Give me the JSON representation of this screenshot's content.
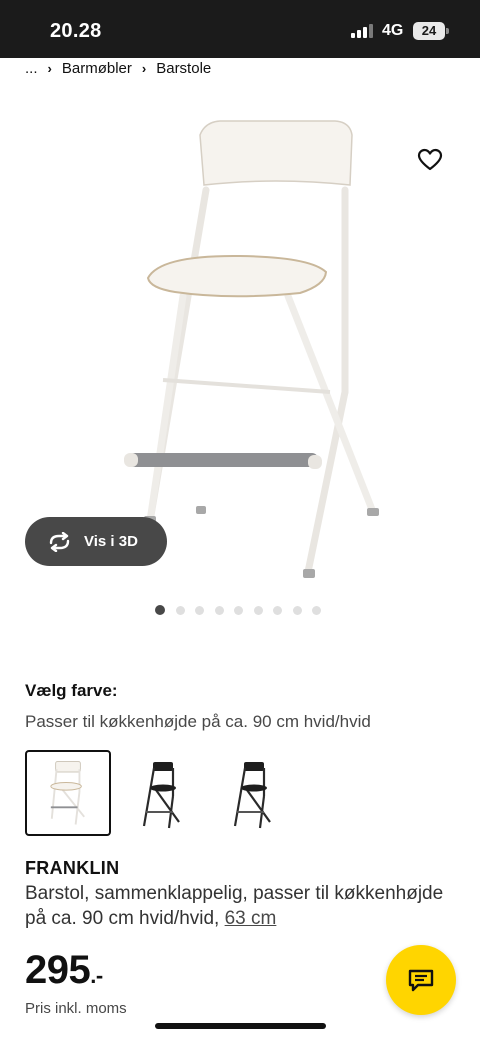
{
  "status_bar": {
    "time": "20.28",
    "network": "4G",
    "battery": "24"
  },
  "breadcrumb": {
    "ellipsis": "...",
    "items": [
      "Barmøbler",
      "Barstole"
    ]
  },
  "gallery": {
    "vis3d_label": "Vis i 3D",
    "image_count": 9,
    "active_index": 0
  },
  "color_picker": {
    "heading": "Vælg farve:",
    "selected_text": "Passer til køkkenhøjde på ca. 90 cm hvid/hvid",
    "swatch_colors": [
      "#ffffff",
      "#1e1e1e",
      "#1e1e1e"
    ]
  },
  "product": {
    "name": "FRANKLIN",
    "description": "Barstol, sammenklappelig, passer til køkkenhøjde på ca. 90 cm hvid/hvid, ",
    "size_link": "63 cm",
    "price": "295",
    "price_suffix": ".-",
    "price_note": "Pris inkl. moms"
  },
  "colors": {
    "accent": "#ffd500",
    "dark": "#111111",
    "button_bg": "#484848"
  }
}
